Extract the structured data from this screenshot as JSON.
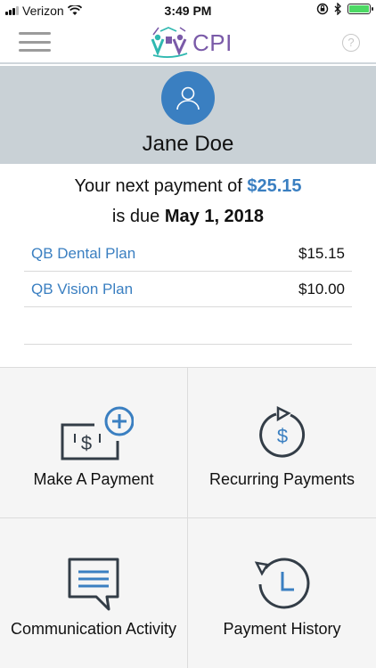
{
  "status_bar": {
    "carrier": "Verizon",
    "time": "3:49 PM"
  },
  "nav": {
    "logo_text": "CPI",
    "help_label": "?"
  },
  "profile": {
    "name": "Jane Doe"
  },
  "summary": {
    "prefix": "Your next payment of",
    "amount": "$25.15",
    "due_prefix": "is due",
    "due_date": "May 1, 2018"
  },
  "plans": [
    {
      "name": "QB Dental Plan",
      "amount": "$15.15"
    },
    {
      "name": "QB Vision Plan",
      "amount": "$10.00"
    }
  ],
  "tiles": [
    {
      "label": "Make A Payment",
      "icon": "payment-add-icon"
    },
    {
      "label": "Recurring Payments",
      "icon": "recurring-dollar-icon"
    },
    {
      "label": "Communication Activity",
      "icon": "chat-bubble-icon"
    },
    {
      "label": "Payment History",
      "icon": "history-clock-icon"
    }
  ],
  "colors": {
    "accent": "#3a7fc1",
    "brand_purple": "#7a5aa8",
    "profile_bg": "#c9d1d6",
    "tile_bg": "#f5f5f5",
    "icon_dark": "#333d47",
    "battery_green": "#4cd964"
  }
}
